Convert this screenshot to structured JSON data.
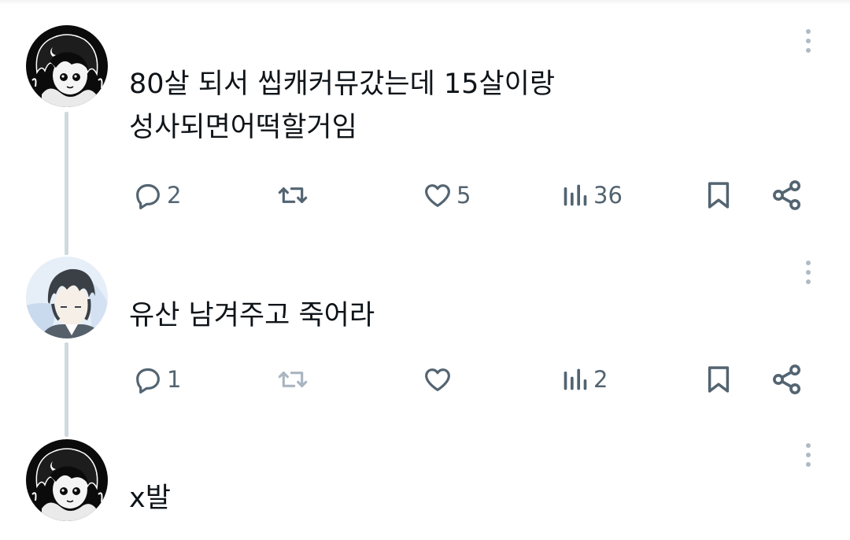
{
  "posts": [
    {
      "text": "80살 되서 씹캐커뮤갔는데 15살이랑\n성사되면어떡할거임",
      "actions": {
        "replies": "2",
        "reposts": "",
        "likes": "5",
        "views": "36"
      }
    },
    {
      "text": "유산 남겨주고 죽어라",
      "actions": {
        "replies": "1",
        "reposts": "",
        "likes": "",
        "views": "2"
      }
    },
    {
      "text": "x발"
    }
  ],
  "icons": {
    "reply": "reply-icon",
    "repost": "repost-icon",
    "like": "like-icon",
    "views": "views-icon",
    "bookmark": "bookmark-icon",
    "share": "share-icon",
    "more": "more-icon"
  },
  "colors": {
    "text": "#0f1419",
    "icon": "#536471",
    "icon_muted": "#a9b6c1",
    "thread_line": "#cfd9de"
  }
}
